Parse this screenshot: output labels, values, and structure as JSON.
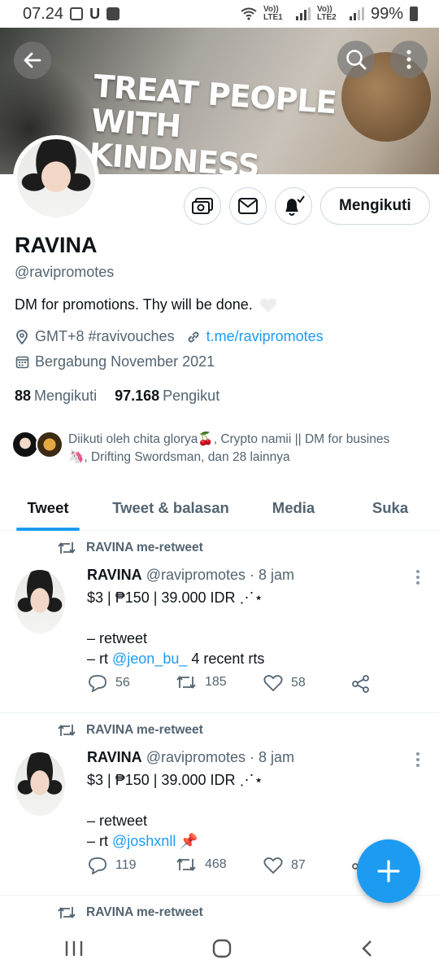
{
  "status_bar": {
    "time": "07.24",
    "volte1": "Vo)) LTE1",
    "volte2": "Vo)) LTE2",
    "battery": "99%"
  },
  "banner": {
    "line1": "TREAT PEOPLE",
    "line2": "WITH KINDNESS"
  },
  "profile": {
    "name": "RAVINA",
    "handle": "@ravipromotes",
    "bio": "DM for promotions. Thy will be done.",
    "location": "GMT+8 #ravivouches",
    "link": "t.me/ravipromotes",
    "joined": "Bergabung November 2021",
    "following_count": "88",
    "following_label": "Mengikuti",
    "followers_count": "97.168",
    "followers_label": "Pengikut",
    "follow_button": "Mengikuti",
    "followed_by_1": "Diikuti oleh chita glorya",
    "followed_by_2": ", Crypto namii || DM for busines",
    "followed_by_3": ", Drifting Swordsman, dan 28 lainnya"
  },
  "tabs": [
    "Tweet",
    "Tweet & balasan",
    "Media",
    "Suka"
  ],
  "tweets": [
    {
      "retweet_label": "RAVINA me-retweet",
      "name": "RAVINA",
      "handle": "@ravipromotes",
      "time": "· 8 jam",
      "line1": "$3 | ₱150 | 39.000 IDR ⋰⋆",
      "line2": "– retweet",
      "line3_prefix": "– rt ",
      "mention": "@jeon_bu_",
      "line3_suffix": " 4 recent rts",
      "replies": "56",
      "retweets": "185",
      "likes": "58"
    },
    {
      "retweet_label": "RAVINA me-retweet",
      "name": "RAVINA",
      "handle": "@ravipromotes",
      "time": "· 8 jam",
      "line1": "$3 | ₱150 | 39.000 IDR ⋰⋆",
      "line2": "– retweet",
      "line3_prefix": "– rt ",
      "mention": "@joshxnll",
      "line3_suffix": " 📌",
      "replies": "119",
      "retweets": "468",
      "likes": "87"
    },
    {
      "retweet_label": "RAVINA me-retweet"
    }
  ],
  "icons": {
    "back": "back-arrow-icon",
    "search": "search-icon",
    "more": "more-vertical-icon",
    "compose": "plus-icon"
  },
  "colors": {
    "accent": "#1d9bf0",
    "text": "#0f1419",
    "secondary": "#536471"
  }
}
